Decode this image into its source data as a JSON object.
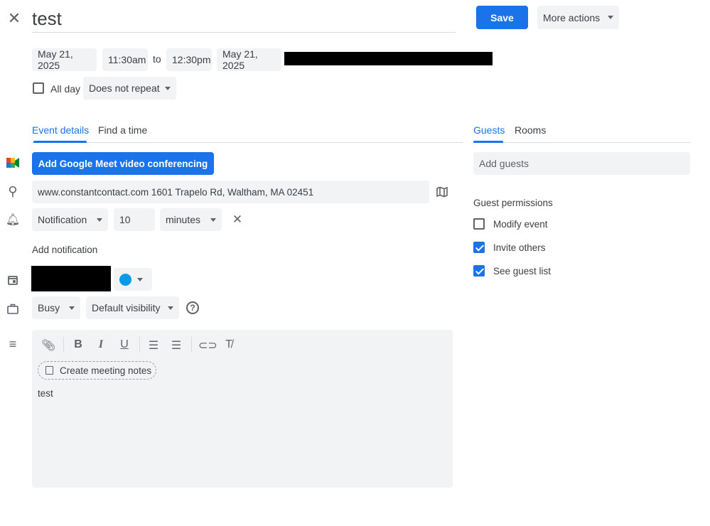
{
  "title": "test",
  "save_label": "Save",
  "more_actions_label": "More actions",
  "start_date": "May 21, 2025",
  "start_time": "11:30am",
  "to_label": "to",
  "end_time": "12:30pm",
  "end_date": "May 21, 2025",
  "all_day_label": "All day",
  "all_day_checked": false,
  "repeat": "Does not repeat",
  "tabs": {
    "event_details": "Event details",
    "find_time": "Find a time"
  },
  "meet_button": "Add Google Meet video conferencing",
  "location": "www.constantcontact.com 1601 Trapelo Rd, Waltham, MA 02451",
  "notification": {
    "type": "Notification",
    "value": "10",
    "unit": "minutes"
  },
  "add_notification": "Add notification",
  "event_color": "#039be5",
  "busy": "Busy",
  "visibility": "Default visibility",
  "toolbar": {
    "notes_button": "Create meeting notes"
  },
  "description": "test",
  "guests": {
    "tabs": {
      "guests": "Guests",
      "rooms": "Rooms"
    },
    "placeholder": "Add guests",
    "permissions_title": "Guest permissions",
    "permissions": [
      {
        "label": "Modify event",
        "checked": false
      },
      {
        "label": "Invite others",
        "checked": true
      },
      {
        "label": "See guest list",
        "checked": true
      }
    ]
  },
  "colors": {
    "accent": "#1a73e8"
  }
}
